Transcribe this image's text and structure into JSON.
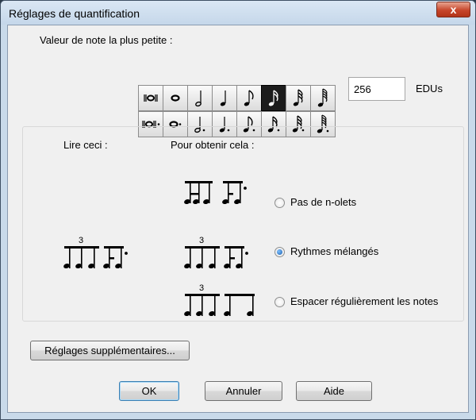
{
  "window": {
    "title": "Réglages de quantification",
    "close_glyph": "x"
  },
  "note_section": {
    "label": "Valeur de note la plus petite :",
    "selected_note": "sixteenth",
    "rows": [
      {
        "name": "undotted",
        "notes": [
          "breve",
          "whole",
          "half",
          "quarter",
          "eighth",
          "sixteenth",
          "thirty-second",
          "sixty-fourth"
        ]
      },
      {
        "name": "dotted",
        "notes": [
          "dotted-breve",
          "dotted-whole",
          "dotted-half",
          "dotted-quarter",
          "dotted-eighth",
          "dotted-sixteenth",
          "dotted-thirty-second",
          "dotted-sixty-fourth"
        ]
      }
    ],
    "edu_value": "256",
    "edu_label": "EDUs"
  },
  "examples": {
    "read_label": "Lire ceci :",
    "result_label": "Pour obtenir cela :",
    "tuplet_number": "3",
    "options": [
      {
        "label": "Pas de n-olets",
        "selected": false
      },
      {
        "label": "Rythmes mélangés",
        "selected": true
      },
      {
        "label": "Espacer régulièrement les notes",
        "selected": false
      }
    ]
  },
  "buttons": {
    "advanced": "Réglages supplémentaires...",
    "ok": "OK",
    "cancel": "Annuler",
    "help": "Aide"
  },
  "colors": {
    "title_bar": "#c9daea",
    "close_button": "#c7462b",
    "dialog_bg": "#f0f0f0",
    "radio_dot": "#1b5fae"
  }
}
